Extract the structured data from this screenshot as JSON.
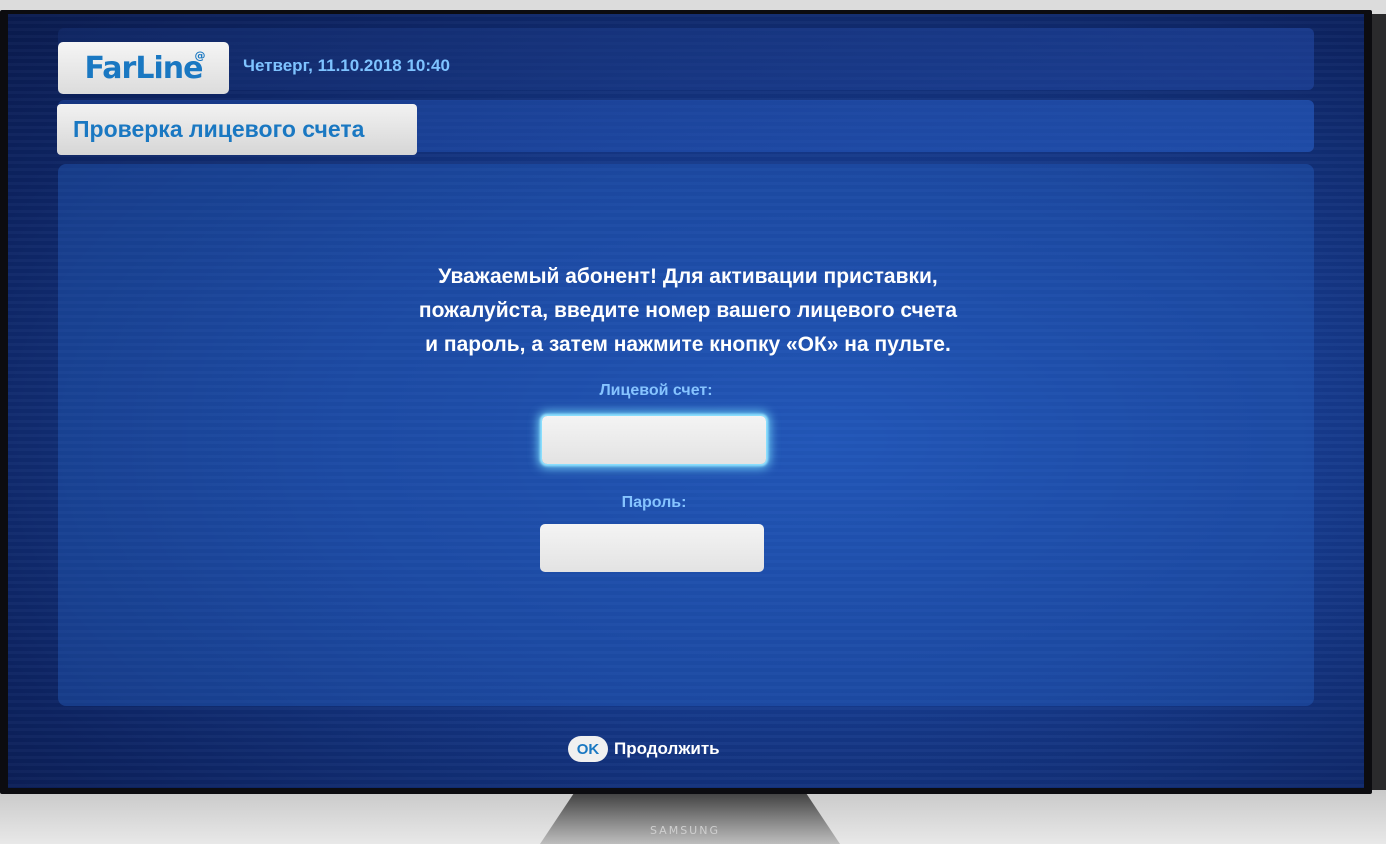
{
  "header": {
    "logo_text_1": "Far",
    "logo_text_2": "Line",
    "logo_mark": "@",
    "datetime": "Четверг, 11.10.2018   10:40"
  },
  "page": {
    "title": "Проверка лицевого счета"
  },
  "message": {
    "line1": "Уважаемый абонент! Для активации приставки,",
    "line2": "пожалуйста, введите номер вашего лицевого счета",
    "line3": "и пароль, а затем нажмите кнопку «ОК» на пульте."
  },
  "form": {
    "account_label": "Лицевой счет:",
    "account_value": "",
    "password_label": "Пароль:",
    "password_value": ""
  },
  "footer": {
    "ok_label": "OK",
    "continue_label": "Продолжить"
  },
  "tv": {
    "brand": "SAMSUNG"
  },
  "colors": {
    "accent": "#1a78c2",
    "label": "#86c4ff",
    "background": "#163a8c"
  }
}
